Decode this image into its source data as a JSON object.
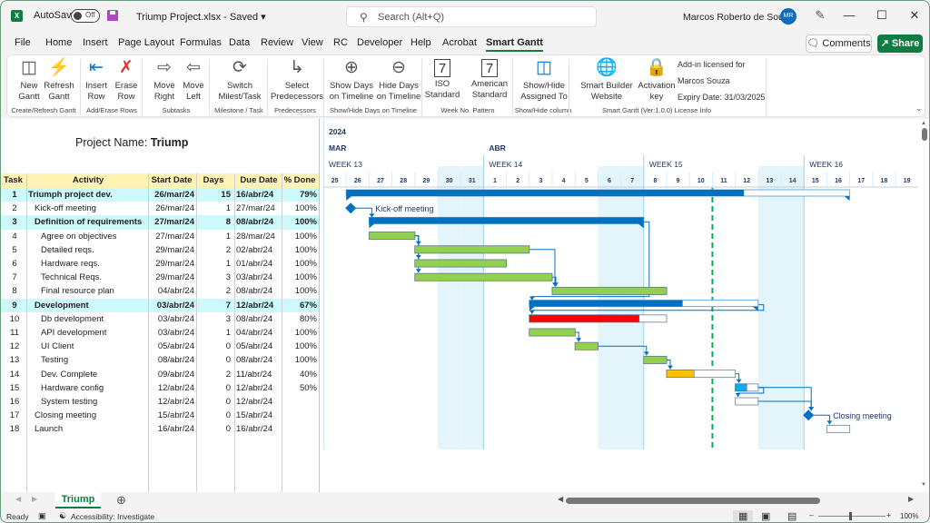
{
  "window": {
    "app_icon": "excel-icon",
    "autosave_label": "AutoSave",
    "autosave_state": "Off",
    "document_title": "Triump Project.xlsx  -  Saved  ▾",
    "search_placeholder": "Search (Alt+Q)",
    "user_name": "Marcos Roberto de Souza",
    "user_initials": "MR",
    "minimize": "—",
    "maximize": "☐",
    "close": "✕"
  },
  "menu_tabs": [
    "File",
    "Home",
    "Insert",
    "Page Layout",
    "Formulas",
    "Data",
    "Review",
    "View",
    "RC",
    "Developer",
    "Help",
    "Acrobat",
    "Smart Gantt"
  ],
  "active_tab": "Smart Gantt",
  "comments_label": "Comments",
  "share_label": "Share",
  "ribbon": {
    "buttons": [
      {
        "l1": "New",
        "l2": "Gantt",
        "icon": "new-gantt-icon"
      },
      {
        "l1": "Refresh",
        "l2": "Gantt",
        "icon": "refresh-gantt-icon"
      },
      {
        "l1": "Insert",
        "l2": "Row",
        "icon": "insert-row-icon"
      },
      {
        "l1": "Erase",
        "l2": "Row",
        "icon": "erase-row-icon"
      },
      {
        "l1": "Move",
        "l2": "Right",
        "icon": "arrow-right-icon"
      },
      {
        "l1": "Move",
        "l2": "Left",
        "icon": "arrow-left-icon"
      },
      {
        "l1": "Switch",
        "l2": "Milest/Task",
        "icon": "switch-icon"
      },
      {
        "l1": "Select",
        "l2": "Predecessors",
        "icon": "predecessors-icon"
      },
      {
        "l1": "Show Days",
        "l2": "on Timeline",
        "icon": "zoom-in-icon"
      },
      {
        "l1": "Hide Days",
        "l2": "on Timeline",
        "icon": "zoom-out-icon"
      },
      {
        "l1": "ISO",
        "l2": "Standard",
        "icon": "calendar-iso-icon"
      },
      {
        "l1": "American",
        "l2": "Standard",
        "icon": "calendar-american-icon"
      },
      {
        "l1": "Show/Hide",
        "l2": "Assigned To",
        "icon": "column-toggle-icon"
      },
      {
        "l1": "Smart Builder",
        "l2": "Website",
        "icon": "globe-icon"
      },
      {
        "l1": "Activation",
        "l2": "key",
        "icon": "lock-key-icon"
      }
    ],
    "groups": [
      "Create/Refresh Gantt",
      "Add/Erase Rows",
      "Subtasks",
      "Milestone / Task",
      "Predecessors",
      "Show/Hide Days on Timeline",
      "Week No. Pattern",
      "Show/Hide column",
      "Smart Gantt (Ver:1.0.0) License Info"
    ],
    "license": {
      "line1": "Add-in licensed for",
      "line2": "Marcos Souza",
      "line3": "Expiry Date: 31/03/2025"
    }
  },
  "project": {
    "label": "Project Name:",
    "name": "Triump"
  },
  "table": {
    "headers": [
      "Task",
      "Activity",
      "Start Date",
      "Days",
      "Due Date",
      "% Done"
    ],
    "rows": [
      {
        "task": "1",
        "activity": "Triumph project dev.",
        "start": "26/mar/24",
        "days": "15",
        "due": "16/abr/24",
        "done": "79%",
        "level": 0,
        "summary": true
      },
      {
        "task": "2",
        "activity": "Kick-off meeting",
        "start": "26/mar/24",
        "days": "1",
        "due": "27/mar/24",
        "done": "100%",
        "level": 1,
        "summary": false
      },
      {
        "task": "3",
        "activity": "Definition of requirements",
        "start": "27/mar/24",
        "days": "8",
        "due": "08/abr/24",
        "done": "100%",
        "level": 1,
        "summary": true
      },
      {
        "task": "4",
        "activity": "Agree on objectives",
        "start": "27/mar/24",
        "days": "1",
        "due": "28/mar/24",
        "done": "100%",
        "level": 2,
        "summary": false
      },
      {
        "task": "5",
        "activity": "Detailed reqs.",
        "start": "29/mar/24",
        "days": "2",
        "due": "02/abr/24",
        "done": "100%",
        "level": 2,
        "summary": false
      },
      {
        "task": "6",
        "activity": "Hardware reqs.",
        "start": "29/mar/24",
        "days": "1",
        "due": "01/abr/24",
        "done": "100%",
        "level": 2,
        "summary": false
      },
      {
        "task": "7",
        "activity": "Technical Reqs.",
        "start": "29/mar/24",
        "days": "3",
        "due": "03/abr/24",
        "done": "100%",
        "level": 2,
        "summary": false
      },
      {
        "task": "8",
        "activity": "Final resource plan",
        "start": "04/abr/24",
        "days": "2",
        "due": "08/abr/24",
        "done": "100%",
        "level": 2,
        "summary": false
      },
      {
        "task": "9",
        "activity": "Development",
        "start": "03/abr/24",
        "days": "7",
        "due": "12/abr/24",
        "done": "67%",
        "level": 1,
        "summary": true
      },
      {
        "task": "10",
        "activity": "Db development",
        "start": "03/abr/24",
        "days": "3",
        "due": "08/abr/24",
        "done": "80%",
        "level": 2,
        "summary": false
      },
      {
        "task": "11",
        "activity": "API development",
        "start": "03/abr/24",
        "days": "1",
        "due": "04/abr/24",
        "done": "100%",
        "level": 2,
        "summary": false
      },
      {
        "task": "12",
        "activity": "UI Client",
        "start": "05/abr/24",
        "days": "0",
        "due": "05/abr/24",
        "done": "100%",
        "level": 2,
        "summary": false
      },
      {
        "task": "13",
        "activity": "Testing",
        "start": "08/abr/24",
        "days": "0",
        "due": "08/abr/24",
        "done": "100%",
        "level": 2,
        "summary": false
      },
      {
        "task": "14",
        "activity": "Dev. Complete",
        "start": "09/abr/24",
        "days": "2",
        "due": "11/abr/24",
        "done": "40%",
        "level": 2,
        "summary": false
      },
      {
        "task": "15",
        "activity": "Hardware config",
        "start": "12/abr/24",
        "days": "0",
        "due": "12/abr/24",
        "done": "50%",
        "level": 2,
        "summary": false
      },
      {
        "task": "16",
        "activity": "System testing",
        "start": "12/abr/24",
        "days": "0",
        "due": "12/abr/24",
        "done": "",
        "level": 2,
        "summary": false
      },
      {
        "task": "17",
        "activity": "Closing meeting",
        "start": "15/abr/24",
        "days": "0",
        "due": "15/abr/24",
        "done": "",
        "level": 1,
        "summary": false
      },
      {
        "task": "18",
        "activity": "Launch",
        "start": "16/abr/24",
        "days": "0",
        "due": "16/abr/24",
        "done": "",
        "level": 1,
        "summary": false
      }
    ]
  },
  "timeline": {
    "year": "2024",
    "months": [
      {
        "label": "MAR",
        "start_index": 0
      },
      {
        "label": "ABR",
        "start_index": 7
      }
    ],
    "weeks": [
      {
        "label": "WEEK 13",
        "start_index": 0
      },
      {
        "label": "WEEK 14",
        "start_index": 7
      },
      {
        "label": "WEEK 15",
        "start_index": 14
      },
      {
        "label": "WEEK 16",
        "start_index": 21
      }
    ],
    "days": [
      "25",
      "26",
      "27",
      "28",
      "29",
      "30",
      "31",
      "1",
      "2",
      "3",
      "4",
      "5",
      "6",
      "7",
      "8",
      "9",
      "10",
      "11",
      "12",
      "13",
      "14",
      "15",
      "16",
      "17",
      "18",
      "19"
    ],
    "weekend_indices": [
      5,
      6,
      12,
      13,
      19,
      20
    ],
    "today_index": 17,
    "colors": {
      "summary": "#0070c0",
      "complete": "#92d050",
      "late": "#ff0000",
      "warning": "#ffc000",
      "progress": "#00b0f0",
      "weekend": "#e3f4fb",
      "week_line": "#9bd3ea",
      "today": "#00b050",
      "link": "#0070c0"
    },
    "bars": [
      {
        "row": 0,
        "type": "summary",
        "start": 1,
        "end": 23,
        "progress": 0.79
      },
      {
        "row": 1,
        "type": "milestone",
        "at": 1,
        "label": "Kick-off meeting"
      },
      {
        "row": 2,
        "type": "summary",
        "start": 2,
        "end": 14,
        "progress": 1.0
      },
      {
        "row": 3,
        "type": "task",
        "start": 2,
        "end": 4,
        "progress": 1.0,
        "color": "complete"
      },
      {
        "row": 4,
        "type": "task",
        "start": 4,
        "end": 9,
        "progress": 1.0,
        "color": "complete"
      },
      {
        "row": 5,
        "type": "task",
        "start": 4,
        "end": 8,
        "progress": 1.0,
        "color": "complete"
      },
      {
        "row": 6,
        "type": "task",
        "start": 4,
        "end": 10,
        "progress": 1.0,
        "color": "complete"
      },
      {
        "row": 7,
        "type": "task",
        "start": 10,
        "end": 15,
        "progress": 1.0,
        "color": "complete"
      },
      {
        "row": 8,
        "type": "summary",
        "start": 9,
        "end": 19,
        "progress": 0.67
      },
      {
        "row": 9,
        "type": "task",
        "start": 9,
        "end": 15,
        "progress": 0.8,
        "color": "late"
      },
      {
        "row": 10,
        "type": "task",
        "start": 9,
        "end": 11,
        "progress": 1.0,
        "color": "complete"
      },
      {
        "row": 11,
        "type": "task",
        "start": 11,
        "end": 12,
        "progress": 1.0,
        "color": "complete"
      },
      {
        "row": 12,
        "type": "task",
        "start": 14,
        "end": 15,
        "progress": 1.0,
        "color": "complete"
      },
      {
        "row": 13,
        "type": "task",
        "start": 15,
        "end": 18,
        "progress": 0.4,
        "color": "warning"
      },
      {
        "row": 14,
        "type": "task",
        "start": 18,
        "end": 19,
        "progress": 0.5,
        "color": "progress"
      },
      {
        "row": 15,
        "type": "task",
        "start": 18,
        "end": 19,
        "progress": 0,
        "color": "progress"
      },
      {
        "row": 16,
        "type": "milestone",
        "at": 21,
        "label": "Closing meeting"
      },
      {
        "row": 17,
        "type": "task",
        "start": 22,
        "end": 23,
        "progress": 0,
        "color": "progress"
      }
    ],
    "links": [
      [
        1,
        2
      ],
      [
        3,
        4
      ],
      [
        3,
        5
      ],
      [
        3,
        6
      ],
      [
        4,
        7
      ],
      [
        6,
        7
      ],
      [
        2,
        8
      ],
      [
        8,
        9
      ],
      [
        10,
        11
      ],
      [
        11,
        12
      ],
      [
        12,
        13
      ],
      [
        13,
        14
      ],
      [
        14,
        15
      ],
      [
        14,
        16
      ],
      [
        15,
        16
      ],
      [
        16,
        17
      ]
    ]
  },
  "sheet_tab": "Triump",
  "status": {
    "ready": "Ready",
    "accessibility": "Accessibility: Investigate",
    "zoom": "100%"
  }
}
